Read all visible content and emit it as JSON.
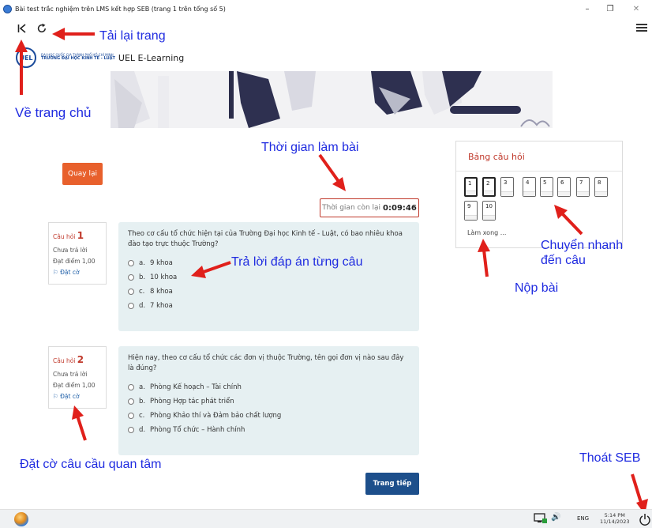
{
  "window": {
    "title": "Bài test trắc nghiệm trên LMS kết hợp SEB (trang 1 trên tổng số 5)",
    "minimize": "–",
    "maximize": "❐",
    "close": "✕"
  },
  "header": {
    "logo_initials": "UEL",
    "university_line": "ĐẠI HỌC QUỐC GIA THÀNH PHỐ HỒ CHÍ MINH",
    "school_line": "TRƯỜNG ĐẠI HỌC KINH TẾ - LUẬT",
    "site_name": "UEL E-Learning"
  },
  "quiz": {
    "back_label": "Quay lại",
    "timer_label": "Thời gian còn lại",
    "timer_value": "0:09:46",
    "next_label": "Trang tiếp",
    "questions": [
      {
        "label": "Câu hỏi",
        "number": "1",
        "status": "Chưa trả lời",
        "points": "Đạt điểm 1,00",
        "flag": "Đặt cờ",
        "text": "Theo cơ cấu tổ chức hiện tại của Trường Đại học Kinh tế - Luật, có bao nhiêu khoa đào tạo trực thuộc Trường?",
        "options": [
          {
            "letter": "a.",
            "text": "9 khoa"
          },
          {
            "letter": "b.",
            "text": "10 khoa"
          },
          {
            "letter": "c.",
            "text": "8 khoa"
          },
          {
            "letter": "d.",
            "text": "7 khoa"
          }
        ]
      },
      {
        "label": "Câu hỏi",
        "number": "2",
        "status": "Chưa trả lời",
        "points": "Đạt điểm 1,00",
        "flag": "Đặt cờ",
        "text": "Hiện nay, theo cơ cấu tổ chức các đơn vị thuộc Trường, tên gọi đơn vị nào sau đây là đúng?",
        "options": [
          {
            "letter": "a.",
            "text": "Phòng Kế hoạch – Tài chính"
          },
          {
            "letter": "b.",
            "text": "Phòng Hợp tác phát triển"
          },
          {
            "letter": "c.",
            "text": "Phòng Khảo thí và Đảm bảo chất lượng"
          },
          {
            "letter": "d.",
            "text": "Phòng Tổ chức – Hành chính"
          }
        ]
      }
    ]
  },
  "navigation": {
    "title": "Bảng câu hỏi",
    "buttons": [
      "1",
      "2",
      "3",
      "4",
      "5",
      "6",
      "7",
      "8",
      "9",
      "10"
    ],
    "finish_label": "Làm xong ..."
  },
  "annotations": {
    "reload": "Tải lại trang",
    "home": "Về trang chủ",
    "time": "Thời gian làm bài",
    "answer": "Trả lời đáp án từng câu",
    "jump_line1": "Chuyển nhanh",
    "jump_line2": "đến câu",
    "submit": "Nộp bài",
    "flag": "Đặt cờ câu cầu quan tâm",
    "exit": "Thoát SEB"
  },
  "taskbar": {
    "language": "ENG",
    "time": "5:14 PM",
    "date": "11/14/2023"
  },
  "colors": {
    "accent_orange": "#e8602c",
    "primary_blue": "#1d4f8b",
    "annotation_blue": "#1f2be0",
    "arrow_red": "#e0201b",
    "question_bg": "#e6f0f2"
  }
}
